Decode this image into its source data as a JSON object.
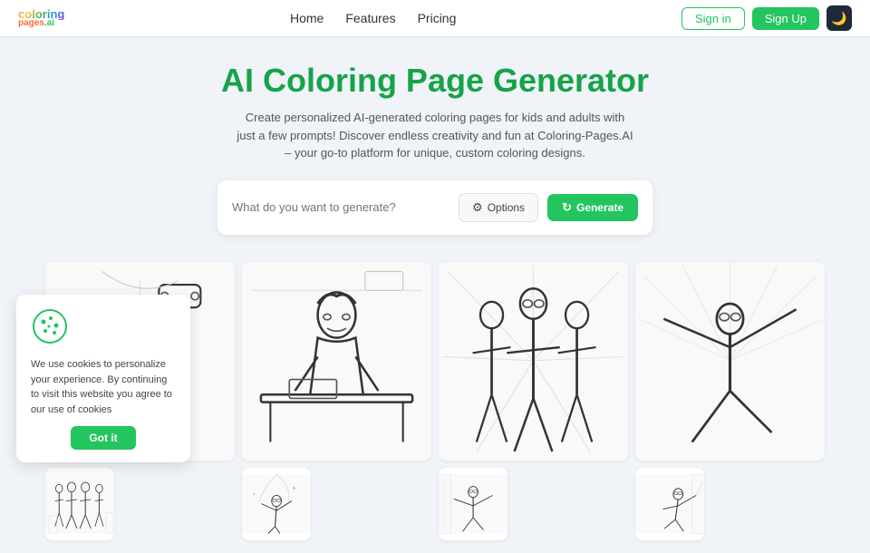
{
  "nav": {
    "logo_line1": "coloring",
    "logo_line2": "pages",
    "logo_ai": ".ai",
    "links": [
      {
        "label": "Home",
        "id": "home"
      },
      {
        "label": "Features",
        "id": "features"
      },
      {
        "label": "Pricing",
        "id": "pricing"
      }
    ],
    "signin_label": "Sign in",
    "signup_label": "Sign Up",
    "dark_mode_icon": "🌙"
  },
  "hero": {
    "title": "AI Coloring Page Generator",
    "subtitle": "Create personalized AI-generated coloring pages for kids and adults with just a few prompts! Discover endless creativity and fun at Coloring-Pages.AI – your go-to platform for unique, custom coloring designs."
  },
  "search": {
    "placeholder": "What do you want to generate?",
    "options_label": "Options",
    "generate_label": "Generate",
    "options_icon": "⚙",
    "generate_icon": "↻"
  },
  "gallery": {
    "items": [
      {
        "id": 1,
        "alt": "Spiderman with drone"
      },
      {
        "id": 2,
        "alt": "Boy at desk"
      },
      {
        "id": 3,
        "alt": "Spider-women group"
      },
      {
        "id": 4,
        "alt": "Spiderman leaping"
      },
      {
        "id": 5,
        "alt": "Spiderman group standing"
      },
      {
        "id": 6,
        "alt": "Spiderman swinging"
      },
      {
        "id": 7,
        "alt": "Spiderman action"
      },
      {
        "id": 8,
        "alt": "Spiderman wall"
      }
    ]
  },
  "cookie": {
    "text": "We use cookies to personalize your experience. By continuing to visit this website you agree to our use of cookies",
    "button_label": "Got it"
  }
}
